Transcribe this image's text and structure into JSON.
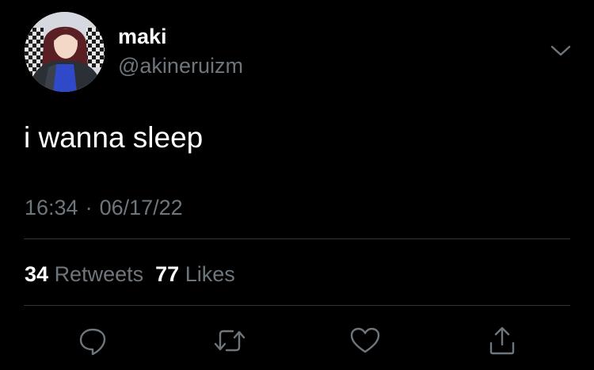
{
  "user": {
    "display_name": "maki",
    "handle": "@akineruizm"
  },
  "tweet": {
    "text": "i wanna sleep",
    "time": "16:34",
    "separator": "·",
    "date": "06/17/22"
  },
  "stats": {
    "retweets_count": "34",
    "retweets_label": "Retweets",
    "likes_count": "77",
    "likes_label": "Likes"
  },
  "actions": {
    "icons": [
      "reply-icon",
      "retweet-icon",
      "like-icon",
      "share-icon"
    ]
  },
  "colors": {
    "background": "#000000",
    "primary_text": "#ffffff",
    "secondary_text": "#6e767d",
    "divider": "#2f3336",
    "icon": "#6e767d"
  }
}
